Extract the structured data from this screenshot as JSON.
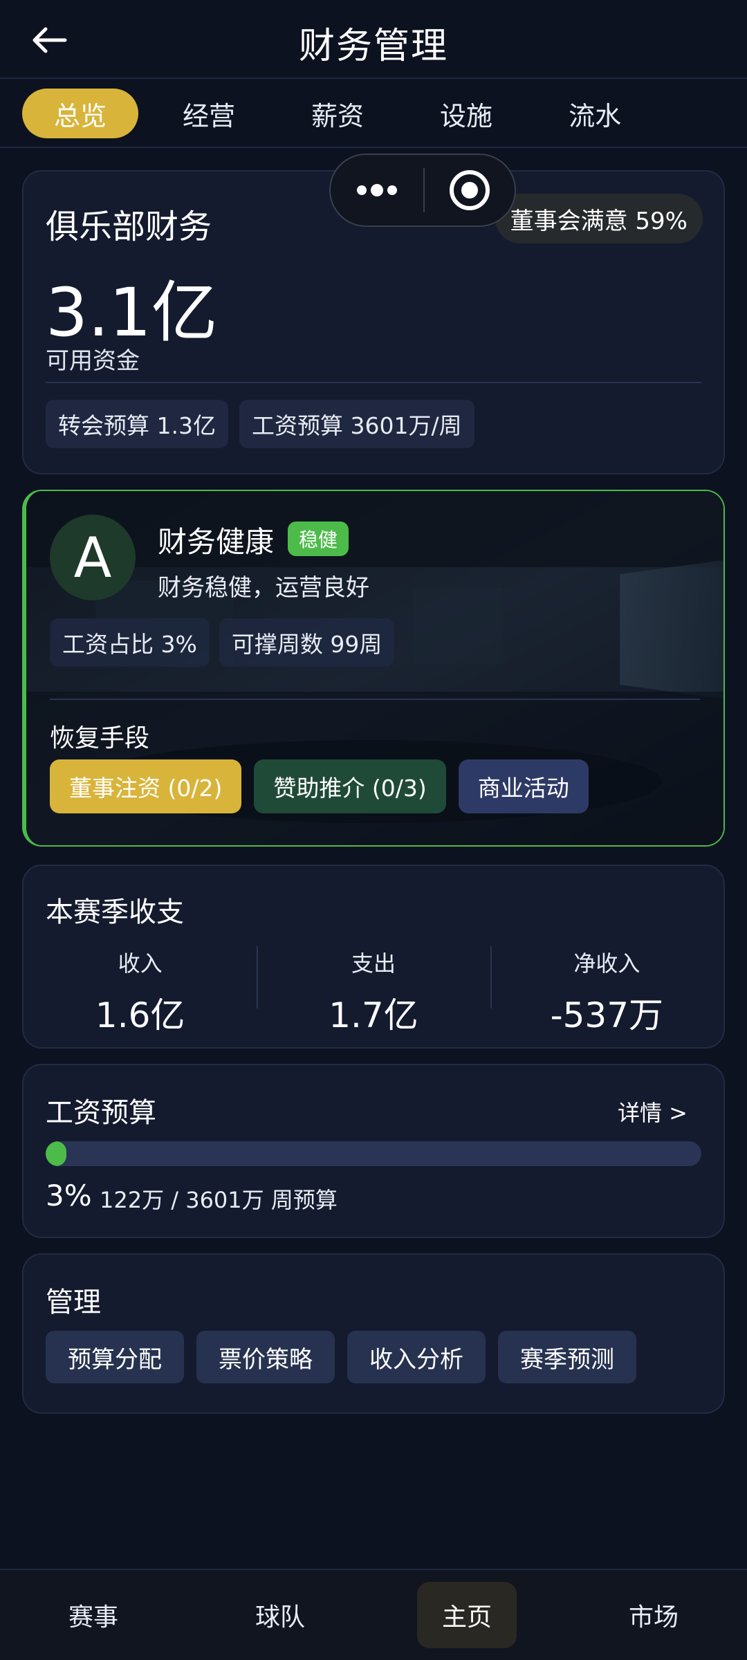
{
  "header": {
    "title": "财务管理"
  },
  "tabs": [
    {
      "label": "总览",
      "active": true
    },
    {
      "label": "经营",
      "active": false
    },
    {
      "label": "薪资",
      "active": false
    },
    {
      "label": "设施",
      "active": false
    },
    {
      "label": "流水",
      "active": false
    }
  ],
  "finance": {
    "title": "俱乐部财务",
    "board_satisfaction": "董事会满意 59%",
    "available_funds": "3.1亿",
    "available_funds_label": "可用资金",
    "transfer_budget": "转会预算 1.3亿",
    "wage_budget": "工资预算 3601万/周"
  },
  "health": {
    "grade": "A",
    "title": "财务健康",
    "status_badge": "稳健",
    "description": "财务稳健，运营良好",
    "wage_ratio": "工资占比 3%",
    "weeks_sustain": "可撑周数 99周",
    "recovery_label": "恢复手段",
    "recovery_buttons": {
      "board_invest": "董事注资 (0/2)",
      "sponsor": "赞助推介 (0/3)",
      "commercial": "商业活动"
    }
  },
  "season": {
    "title": "本赛季收支",
    "income_label": "收入",
    "income_value": "1.6亿",
    "expense_label": "支出",
    "expense_value": "1.7亿",
    "net_label": "净收入",
    "net_value": "-537万"
  },
  "salary": {
    "title": "工资预算",
    "detail_link": "详情 >",
    "percent_text": "3%",
    "progress_fraction": 0.03,
    "info": "122万 / 3601万 周预算",
    "fill_color": "#4cbb4a"
  },
  "manage": {
    "title": "管理",
    "buttons": {
      "budget": "预算分配",
      "ticket": "票价策略",
      "income": "收入分析",
      "forecast": "赛季预测"
    }
  },
  "bottom_nav": {
    "items": [
      {
        "label": "赛事",
        "active": false
      },
      {
        "label": "球队",
        "active": false
      },
      {
        "label": "主页",
        "active": true
      },
      {
        "label": "市场",
        "active": false
      }
    ]
  },
  "colors": {
    "accent_gold": "#d9b43a",
    "health_green": "#4cbb4a",
    "background": "#0d1220"
  }
}
